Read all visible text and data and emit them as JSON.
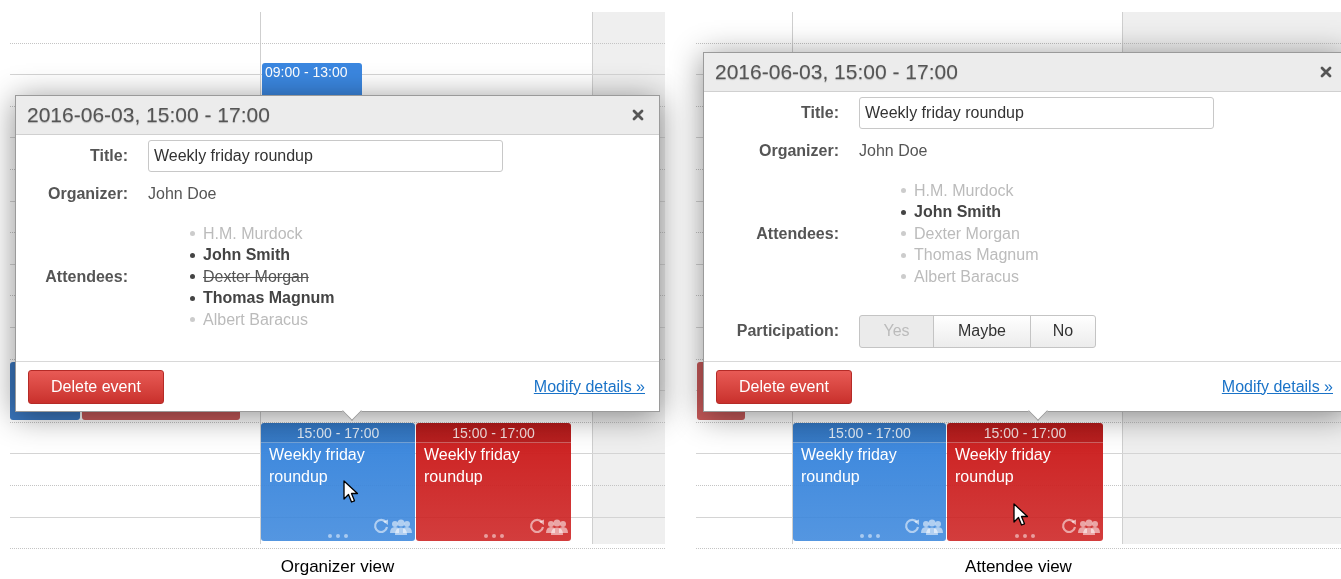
{
  "views": [
    {
      "caption": "Organizer view",
      "background_events": [
        {
          "time": "09:00 - 13:00",
          "color": "#3b87e0"
        }
      ],
      "popup": {
        "heading": "2016-06-03, 15:00 - 17:00",
        "fields": [
          {
            "kind": "input",
            "label": "Title:",
            "value": "Weekly friday roundup"
          },
          {
            "kind": "text",
            "label": "Organizer:",
            "value": "John Doe"
          },
          {
            "kind": "attendees",
            "label": "Attendees:",
            "attendees": [
              {
                "name": "H.M. Murdock",
                "accepted": false,
                "declined": false
              },
              {
                "name": "John Smith",
                "accepted": true,
                "declined": false
              },
              {
                "name": "Dexter Morgan",
                "accepted": false,
                "declined": true
              },
              {
                "name": "Thomas Magnum",
                "accepted": true,
                "declined": false
              },
              {
                "name": "Albert Baracus",
                "accepted": false,
                "declined": false
              }
            ]
          }
        ],
        "delete_button": "Delete event",
        "modify_link": "Modify details »"
      },
      "events": [
        {
          "time": "15:00 - 17:00",
          "title": "Weekly friday roundup",
          "color": "#3a86dc"
        },
        {
          "time": "15:00 - 17:00",
          "title": "Weekly friday roundup",
          "color": "#cc1f1f"
        }
      ]
    },
    {
      "caption": "Attendee view",
      "popup": {
        "heading": "2016-06-03, 15:00 - 17:00",
        "fields": [
          {
            "kind": "input",
            "label": "Title:",
            "value": "Weekly friday roundup"
          },
          {
            "kind": "text",
            "label": "Organizer:",
            "value": "John Doe"
          },
          {
            "kind": "attendees",
            "label": "Attendees:",
            "attendees": [
              {
                "name": "H.M. Murdock",
                "accepted": false,
                "declined": false
              },
              {
                "name": "John Smith",
                "accepted": true,
                "declined": false
              },
              {
                "name": "Dexter Morgan",
                "accepted": false,
                "declined": false
              },
              {
                "name": "Thomas Magnum",
                "accepted": false,
                "declined": false
              },
              {
                "name": "Albert Baracus",
                "accepted": false,
                "declined": false
              }
            ]
          },
          {
            "kind": "choice",
            "label": "Participation:",
            "options": [
              {
                "label": "Yes",
                "selected": true
              },
              {
                "label": "Maybe",
                "selected": false
              },
              {
                "label": "No",
                "selected": false
              }
            ]
          }
        ],
        "delete_button": "Delete event",
        "modify_link": "Modify details »"
      },
      "events": [
        {
          "time": "15:00 - 17:00",
          "title": "Weekly friday roundup",
          "color": "#3a86dc"
        },
        {
          "time": "15:00 - 17:00",
          "title": "Weekly friday roundup",
          "color": "#cc1f1f"
        }
      ]
    }
  ]
}
